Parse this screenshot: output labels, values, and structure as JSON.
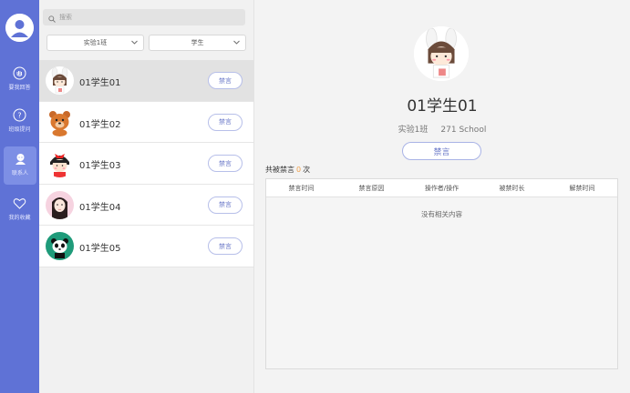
{
  "rail": {
    "items": [
      {
        "label": "要我回答",
        "icon": "hand-raise-icon"
      },
      {
        "label": "班级提问",
        "icon": "question-icon"
      },
      {
        "label": "联系人",
        "icon": "contacts-icon",
        "active": true
      },
      {
        "label": "我的收藏",
        "icon": "heart-icon"
      }
    ]
  },
  "search": {
    "placeholder": "搜索"
  },
  "filters": {
    "class": "实验1班",
    "role": "学生"
  },
  "students": [
    {
      "name": "01学生01",
      "button": "禁言",
      "avatar": "girl-bunny-avatar"
    },
    {
      "name": "01学生02",
      "button": "禁言",
      "avatar": "bear-avatar"
    },
    {
      "name": "01学生03",
      "button": "禁言",
      "avatar": "maruko-avatar"
    },
    {
      "name": "01学生04",
      "button": "禁言",
      "avatar": "girl-pink-avatar"
    },
    {
      "name": "01学生05",
      "button": "禁言",
      "avatar": "panda-avatar"
    }
  ],
  "detail": {
    "name": "01学生01",
    "class": "实验1班",
    "school": "271 School",
    "mute_button": "禁言",
    "count_prefix": "共被禁言",
    "count": "0",
    "count_suffix": "次",
    "columns": [
      "禁言时间",
      "禁言原因",
      "操作者/操作",
      "被禁时长",
      "解禁时间"
    ],
    "empty_text": "没有相关内容"
  },
  "colors": {
    "accent": "#5f72d6",
    "button_text": "#6d7bc9",
    "count": "#f0a04b"
  }
}
